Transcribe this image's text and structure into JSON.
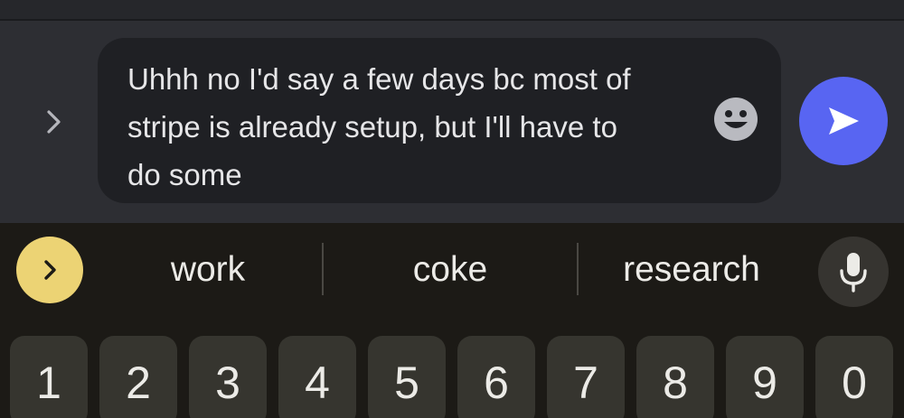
{
  "composer": {
    "message_text": "Uhhh no I'd say a few days bc most of\nstripe is already setup, but I'll have to\ndo some",
    "expand_icon": "chevron-right-icon",
    "emoji_icon": "smiley-face-icon",
    "send_icon": "send-arrow-icon"
  },
  "keyboard": {
    "expand_icon": "chevron-right-icon",
    "suggestions": [
      "work",
      "coke",
      "research"
    ],
    "mic_icon": "microphone-icon",
    "number_row": [
      "1",
      "2",
      "3",
      "4",
      "5",
      "6",
      "7",
      "8",
      "9",
      "0"
    ]
  },
  "colors": {
    "composer_bg": "#2d2e33",
    "message_box_bg": "#1f2024",
    "send_button": "#5865f2",
    "keyboard_bg": "#1c1a16",
    "key_bg": "#36352f",
    "keyboard_accent": "#ecd374"
  }
}
